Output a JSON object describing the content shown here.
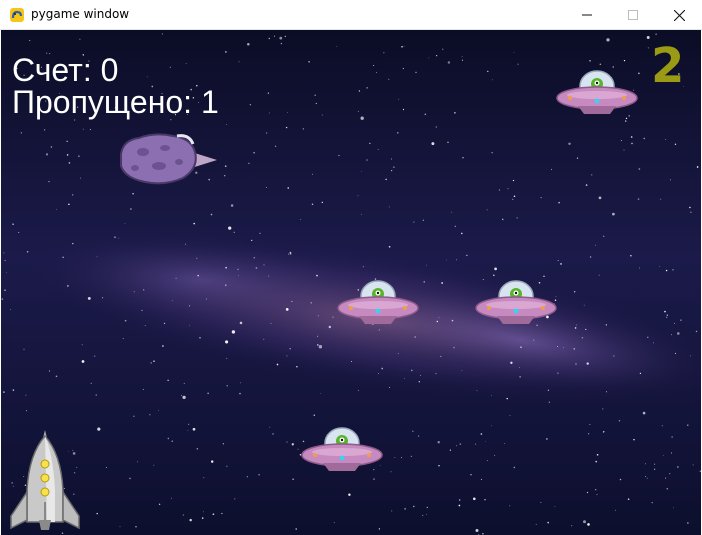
{
  "window": {
    "title": "pygame window",
    "icon": "pygame-snake-icon"
  },
  "hud": {
    "score_label": "Счет:",
    "score_value": "0",
    "missed_label": "Пропущено:",
    "missed_value": "1",
    "level": "2",
    "level_color": "#9a9a14"
  },
  "sprites": {
    "ufo_count": 4,
    "asteroid_count": 1,
    "player": "rocket"
  }
}
